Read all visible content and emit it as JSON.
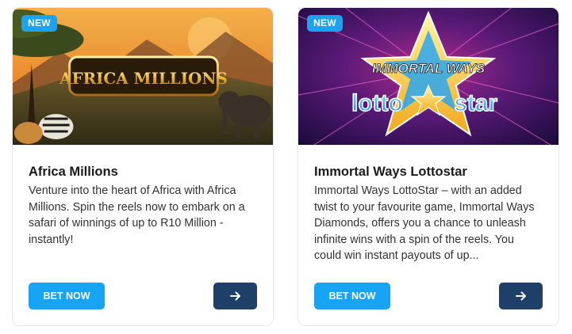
{
  "cards": [
    {
      "badge": "NEW",
      "title": "Africa Millions",
      "description": "Venture into the heart of Africa with Africa Millions. Spin the reels now to embark on a safari of winnings of up to R10 Million - instantly!",
      "logo_text": "AFRICA MILLIONS",
      "bet_label": "BET NOW",
      "arrow_icon": "arrow-right-icon"
    },
    {
      "badge": "NEW",
      "title": "Immortal Ways Lottostar",
      "description": "Immortal Ways LottoStar – with an added twist to your favourite game, Immortal Ways Diamonds, offers you a chance to unleash infinite wins with a spin of the reels. You could win instant payouts of up...",
      "logo_text_top": "IMMORTAL WAYS",
      "logo_text_bottom_left": "lotto",
      "logo_text_bottom_right": "star",
      "bet_label": "BET NOW",
      "arrow_icon": "arrow-right-icon"
    }
  ],
  "colors": {
    "badge": "#1aa3f2",
    "bet_button": "#17a4f5",
    "arrow_button": "#1e3f68"
  }
}
